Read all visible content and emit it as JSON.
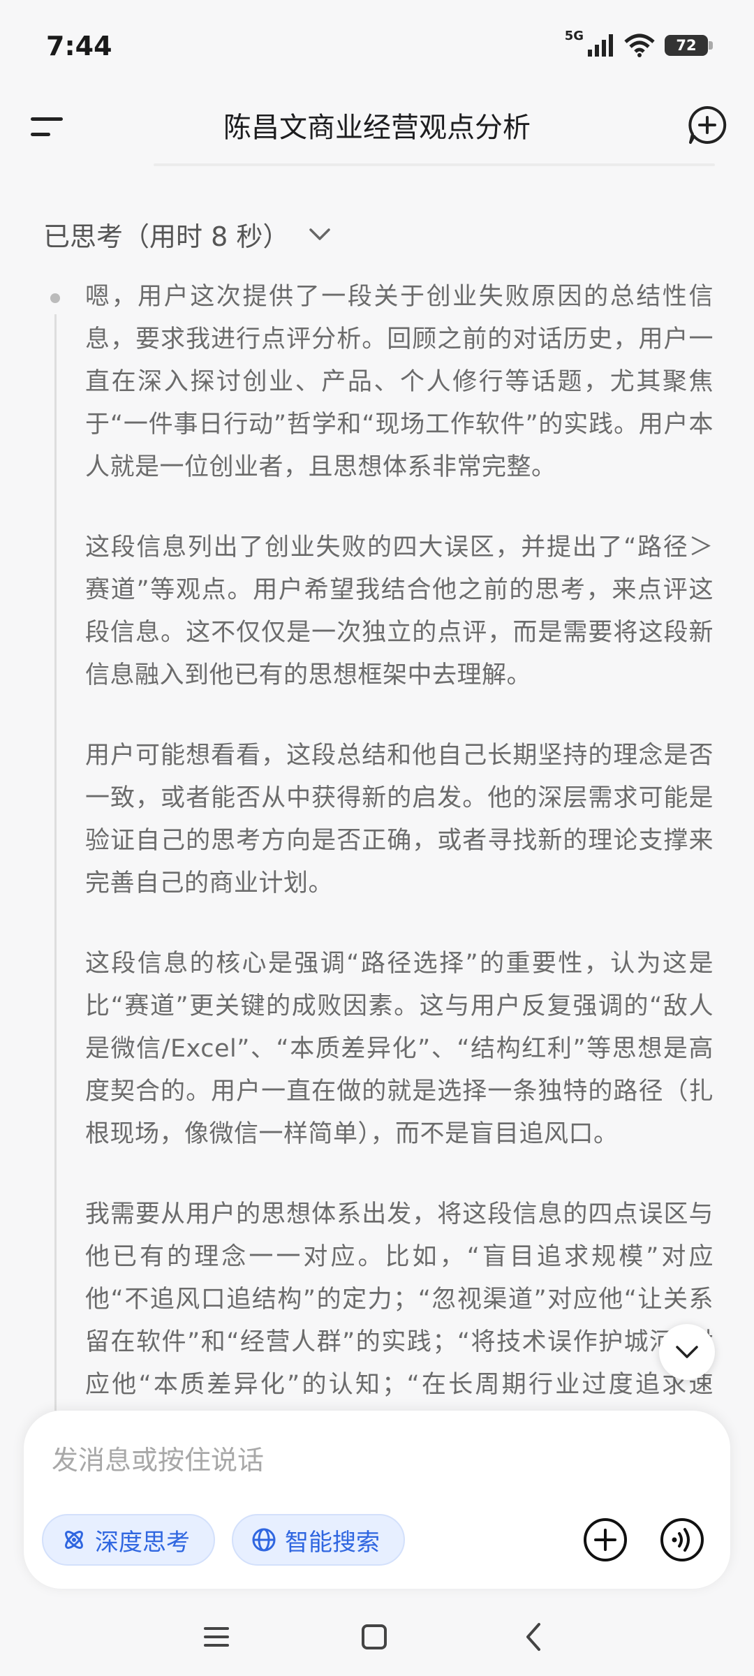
{
  "status_bar": {
    "time": "7:44",
    "network": "5G",
    "battery": "72"
  },
  "header": {
    "title": "陈昌文商业经营观点分析"
  },
  "thinking": {
    "label": "已思考（用时 8 秒）",
    "paragraphs": [
      "嗯，用户这次提供了一段关于创业失败原因的总结性信息，要求我进行点评分析。回顾之前的对话历史，用户一直在深入探讨创业、产品、个人修行等话题，尤其聚焦于“一件事日行动”哲学和“现场工作软件”的实践。用户本人就是一位创业者，且思想体系非常完整。",
      "这段信息列出了创业失败的四大误区，并提出了“路径＞赛道”等观点。用户希望我结合他之前的思考，来点评这段信息。这不仅仅是一次独立的点评，而是需要将这段新信息融入到他已有的思想框架中去理解。",
      "用户可能想看看，这段总结和他自己长期坚持的理念是否一致，或者能否从中获得新的启发。他的深层需求可能是验证自己的思考方向是否正确，或者寻找新的理论支撑来完善自己的商业计划。",
      "这段信息的核心是强调“路径选择”的重要性，认为这是比“赛道”更关键的成败因素。这与用户反复强调的“敌人是微信/Excel”、“本质差异化”、“结构红利”等思想是高度契合的。用户一直在做的就是选择一条独特的路径（扎根现场，像微信一样简单），而不是盲目追风口。",
      "我需要从用户的思想体系出发，将这段信息的四点误区与他已有的理念一一对应。比如，“盲目追求规模”对应他“不追风口追结构”的定力；“忽视渠道”对应他“让关系留在软件”和“经营人群”的实践；“将技术误作护城河”对应他“本质差异化”的认知；“在长周期行业过度追求速度”对应他“长期主义”的坚持。"
    ]
  },
  "composer": {
    "placeholder": "发消息或按住说话",
    "deep_think_label": "深度思考",
    "smart_search_label": "智能搜索"
  },
  "colors": {
    "accent": "#2f66e0",
    "chip_bg": "#e7efff",
    "thought_text": "#6b6b6b"
  },
  "icons": [
    "menu-icon",
    "new-chat-icon",
    "chevron-down-icon",
    "atom-icon",
    "globe-icon",
    "plus-circle-icon",
    "voice-icon",
    "nav-menu-icon",
    "nav-home-icon",
    "nav-back-icon"
  ]
}
